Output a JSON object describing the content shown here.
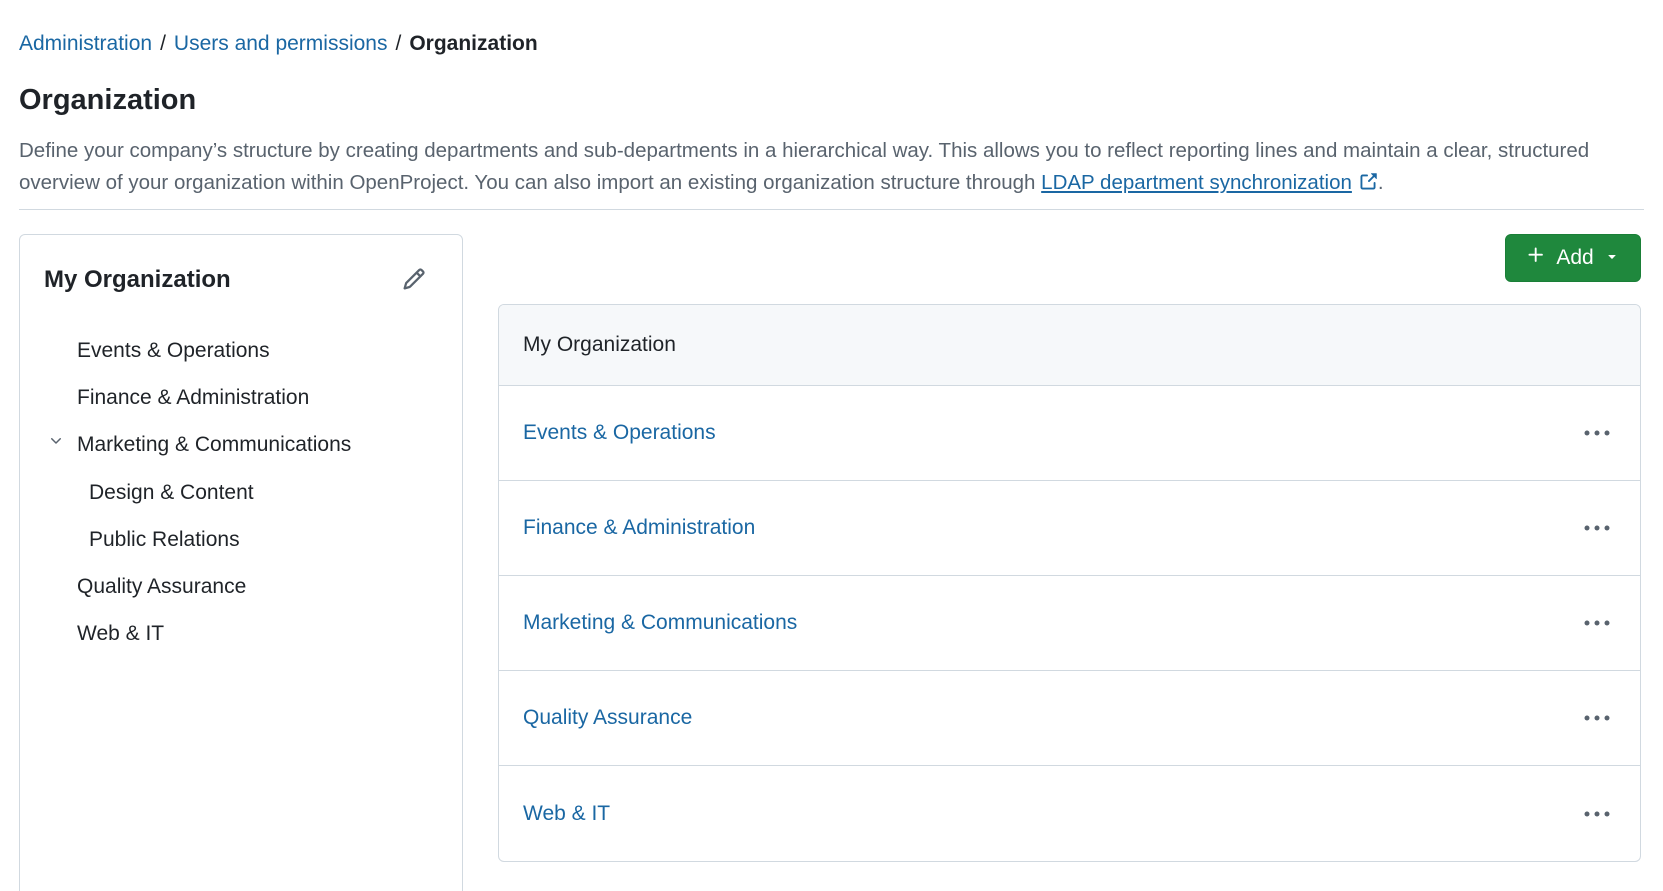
{
  "breadcrumb": {
    "items": [
      "Administration",
      "Users and permissions"
    ],
    "current": "Organization",
    "separator": "/"
  },
  "page": {
    "title": "Organization",
    "description_before": "Define your company’s structure by creating departments and sub-departments in a hierarchical way. This allows you to reflect reporting lines and maintain a clear, structured overview of your organization within OpenProject. You can also import an existing organization structure through ",
    "description_link": "LDAP department synchronization",
    "description_after": "."
  },
  "tree": {
    "title": "My Organization",
    "edit_icon": "pencil-icon",
    "items": [
      {
        "label": "Events & Operations",
        "level": 0
      },
      {
        "label": "Finance & Administration",
        "level": 0
      },
      {
        "label": "Marketing & Communications",
        "level": 0,
        "expanded": true
      },
      {
        "label": "Design & Content",
        "level": 1
      },
      {
        "label": "Public Relations",
        "level": 1
      },
      {
        "label": "Quality Assurance",
        "level": 0
      },
      {
        "label": "Web & IT",
        "level": 0
      }
    ]
  },
  "add_button": {
    "label": "Add",
    "icon": "plus-icon",
    "dropdown_icon": "triangle-down-icon"
  },
  "list": {
    "header": "My Organization",
    "rows": [
      "Events & Operations",
      "Finance & Administration",
      "Marketing & Communications",
      "Quality Assurance",
      "Web & IT"
    ]
  },
  "colors": {
    "link": "#1a67a3",
    "primary": "#1f883d",
    "border": "#d1d9e0",
    "header_bg": "#f6f8fa"
  }
}
